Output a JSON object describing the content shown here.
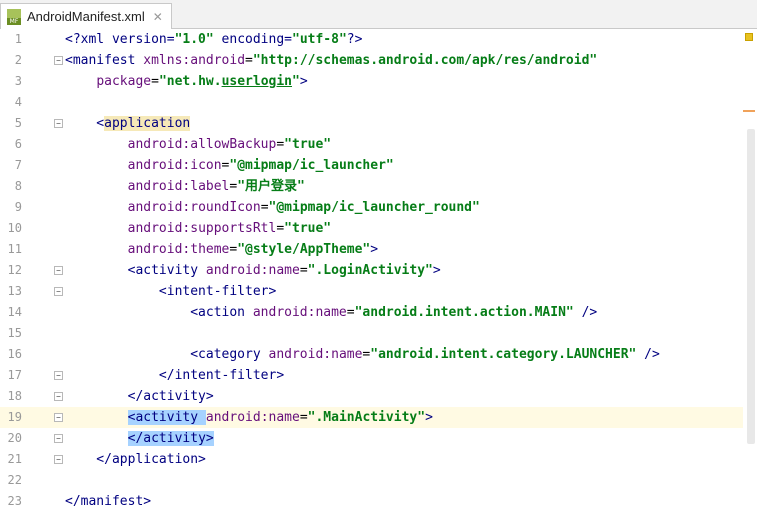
{
  "tab": {
    "filename": "AndroidManifest.xml",
    "icon": "mf-file-icon",
    "icon_text": "MF",
    "close": "✕"
  },
  "lines": [
    {
      "n": "1",
      "segs": [
        [
          "t",
          "<?xml version="
        ],
        [
          "v",
          "\"1.0\""
        ],
        [
          "t",
          " encoding="
        ],
        [
          "v",
          "\"utf-8\""
        ],
        [
          "t",
          "?>"
        ]
      ]
    },
    {
      "n": "2",
      "segs": [
        [
          "t",
          "<manifest "
        ],
        [
          "ns",
          "xmlns:android"
        ],
        [
          "p",
          "="
        ],
        [
          "v",
          "\"http://schemas.android.com/apk/res/android\""
        ]
      ]
    },
    {
      "n": "3",
      "segs": [
        [
          "t",
          "    "
        ],
        [
          "a",
          "package"
        ],
        [
          "p",
          "="
        ],
        [
          "v",
          "\"net.hw."
        ],
        [
          "vu",
          "userlogin"
        ],
        [
          "v",
          "\""
        ],
        [
          "t",
          ">"
        ]
      ]
    },
    {
      "n": "4",
      "segs": []
    },
    {
      "n": "5",
      "segs": [
        [
          "t",
          "    <"
        ],
        [
          "ty",
          "application"
        ]
      ]
    },
    {
      "n": "6",
      "segs": [
        [
          "t",
          "        "
        ],
        [
          "a",
          "android:allowBackup"
        ],
        [
          "p",
          "="
        ],
        [
          "v",
          "\"true\""
        ]
      ]
    },
    {
      "n": "7",
      "segs": [
        [
          "t",
          "        "
        ],
        [
          "a",
          "android:icon"
        ],
        [
          "p",
          "="
        ],
        [
          "v",
          "\"@mipmap/ic_launcher\""
        ]
      ]
    },
    {
      "n": "8",
      "segs": [
        [
          "t",
          "        "
        ],
        [
          "a",
          "android:label"
        ],
        [
          "p",
          "="
        ],
        [
          "v",
          "\"用户登录\""
        ]
      ]
    },
    {
      "n": "9",
      "segs": [
        [
          "t",
          "        "
        ],
        [
          "a",
          "android:roundIcon"
        ],
        [
          "p",
          "="
        ],
        [
          "v",
          "\"@mipmap/ic_launcher_round\""
        ]
      ]
    },
    {
      "n": "10",
      "segs": [
        [
          "t",
          "        "
        ],
        [
          "a",
          "android:supportsRtl"
        ],
        [
          "p",
          "="
        ],
        [
          "v",
          "\"true\""
        ]
      ]
    },
    {
      "n": "11",
      "segs": [
        [
          "t",
          "        "
        ],
        [
          "a",
          "android:theme"
        ],
        [
          "p",
          "="
        ],
        [
          "v",
          "\"@style/AppTheme\""
        ],
        [
          "t",
          ">"
        ]
      ]
    },
    {
      "n": "12",
      "segs": [
        [
          "t",
          "        <activity "
        ],
        [
          "a",
          "android:name"
        ],
        [
          "p",
          "="
        ],
        [
          "v",
          "\".LoginActivity\""
        ],
        [
          "t",
          ">"
        ]
      ]
    },
    {
      "n": "13",
      "segs": [
        [
          "t",
          "            <intent-filter>"
        ]
      ]
    },
    {
      "n": "14",
      "segs": [
        [
          "t",
          "                <action "
        ],
        [
          "a",
          "android:name"
        ],
        [
          "p",
          "="
        ],
        [
          "v",
          "\"android.intent.action.MAIN\""
        ],
        [
          "t",
          " />"
        ]
      ]
    },
    {
      "n": "15",
      "segs": []
    },
    {
      "n": "16",
      "segs": [
        [
          "t",
          "                <category "
        ],
        [
          "a",
          "android:name"
        ],
        [
          "p",
          "="
        ],
        [
          "v",
          "\"android.intent.category.LAUNCHER\""
        ],
        [
          "t",
          " />"
        ]
      ]
    },
    {
      "n": "17",
      "segs": [
        [
          "t",
          "            </intent-filter>"
        ]
      ]
    },
    {
      "n": "18",
      "segs": [
        [
          "t",
          "        </activity>"
        ]
      ]
    },
    {
      "n": "19",
      "segs": [
        [
          "t",
          "        "
        ],
        [
          "ts",
          "<activity "
        ],
        [
          "a",
          "android:name"
        ],
        [
          "p",
          "="
        ],
        [
          "v",
          "\".MainActivity\""
        ],
        [
          "t",
          ">"
        ]
      ],
      "current": true
    },
    {
      "n": "20",
      "segs": [
        [
          "t",
          "        "
        ],
        [
          "ts",
          "</activity>"
        ]
      ]
    },
    {
      "n": "21",
      "segs": [
        [
          "t",
          "    </application>"
        ]
      ]
    },
    {
      "n": "22",
      "segs": []
    },
    {
      "n": "23",
      "segs": [
        [
          "t",
          "</manifest>"
        ]
      ]
    }
  ],
  "folds": [
    "2",
    "5",
    "12",
    "13",
    "17",
    "18",
    "19",
    "20",
    "21"
  ],
  "colors": {
    "tag": "#000080",
    "attr": "#660e7a",
    "value": "#067d17",
    "current_line": "#fffae3",
    "selection": "#a6d2ff",
    "tag_highlight": "#f6e9b8"
  }
}
